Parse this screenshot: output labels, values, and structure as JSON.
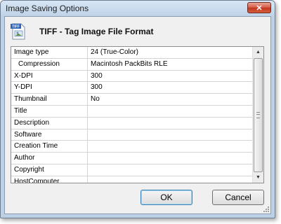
{
  "window": {
    "title": "Image Saving Options",
    "close_symbol": "✕"
  },
  "header": {
    "icon": "tiff-file-icon",
    "icon_text": "TIFF",
    "title": "TIFF - Tag Image File Format"
  },
  "grid": {
    "rows": [
      {
        "label": "Image type",
        "value": "24 (True-Color)"
      },
      {
        "label": "Compression",
        "value": "Macintosh PackBits RLE"
      },
      {
        "label": "X-DPI",
        "value": "300"
      },
      {
        "label": "Y-DPI",
        "value": "300"
      },
      {
        "label": "Thumbnail",
        "value": "No"
      },
      {
        "label": "Title",
        "value": ""
      },
      {
        "label": "Description",
        "value": ""
      },
      {
        "label": "Software",
        "value": ""
      },
      {
        "label": "Creation Time",
        "value": ""
      },
      {
        "label": "Author",
        "value": ""
      },
      {
        "label": "Copyright",
        "value": ""
      },
      {
        "label": "HostComputer",
        "value": ""
      }
    ],
    "scroll_up_symbol": "▲",
    "scroll_down_symbol": "▼"
  },
  "buttons": {
    "ok": "OK",
    "cancel": "Cancel"
  },
  "colors": {
    "frame": "#bcd0e6",
    "client": "#f0f0f0",
    "close_button": "#c0381f"
  }
}
